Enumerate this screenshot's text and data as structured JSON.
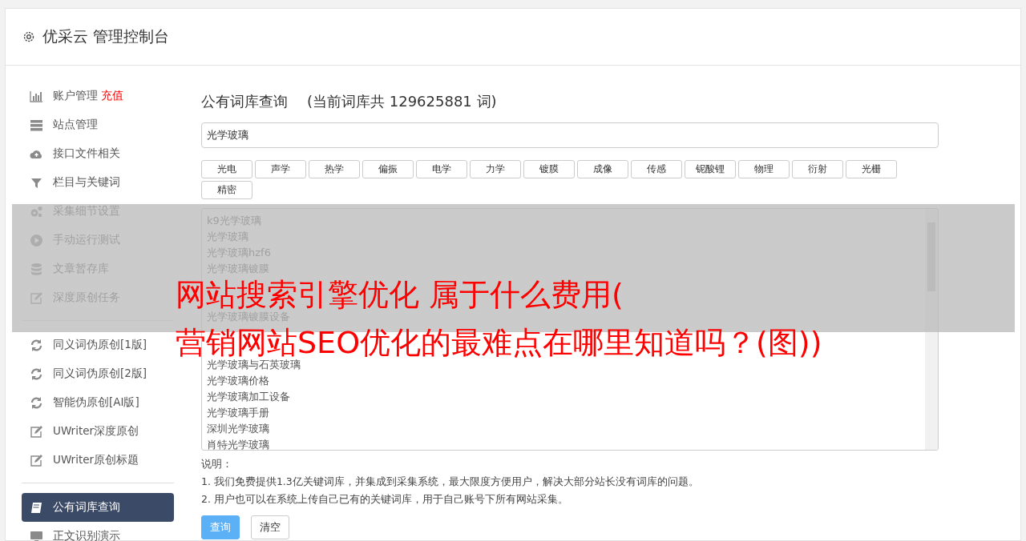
{
  "header": {
    "title": "优采云 管理控制台"
  },
  "sidebar": {
    "groups": [
      {
        "items": [
          {
            "kind": "chart",
            "label": "账户管理",
            "badge": "充值",
            "selected": false
          },
          {
            "kind": "server",
            "label": "站点管理",
            "selected": false
          },
          {
            "kind": "cloud",
            "label": "接口文件相关",
            "selected": false
          },
          {
            "kind": "filter",
            "label": "栏目与关键词",
            "selected": false
          },
          {
            "kind": "gears",
            "label": "采集细节设置",
            "selected": false
          },
          {
            "kind": "play",
            "label": "手动运行测试",
            "selected": false
          },
          {
            "kind": "database",
            "label": "文章暂存库",
            "selected": false
          },
          {
            "kind": "edit",
            "label": "深度原创任务",
            "selected": false
          }
        ]
      },
      {
        "items": [
          {
            "kind": "refresh",
            "label": "同义词伪原创[1版]",
            "selected": false
          },
          {
            "kind": "refresh",
            "label": "同义词伪原创[2版]",
            "selected": false
          },
          {
            "kind": "refresh",
            "label": "智能伪原创[AI版]",
            "selected": false
          },
          {
            "kind": "edit",
            "label": "UWriter深度原创",
            "selected": false
          },
          {
            "kind": "edit",
            "label": "UWriter原创标题",
            "selected": false
          }
        ]
      },
      {
        "items": [
          {
            "kind": "book",
            "label": "公有词库查询",
            "selected": true
          },
          {
            "kind": "monitor",
            "label": "正文识别演示",
            "selected": false
          }
        ]
      }
    ]
  },
  "main": {
    "title": "公有词库查询",
    "subtitle": "(当前词库共 129625881 词)",
    "search": {
      "value": "光学玻璃"
    },
    "tags": [
      "光电",
      "声学",
      "热学",
      "偏振",
      "电学",
      "力学",
      "镀膜",
      "成像",
      "传感",
      "铌酸锂",
      "物理",
      "衍射",
      "光栅",
      "精密"
    ],
    "results": [
      {
        "kind": "text",
        "text": "k9光学玻璃"
      },
      {
        "kind": "text",
        "text": "光学玻璃"
      },
      {
        "kind": "text",
        "text": "光学玻璃hzf6"
      },
      {
        "kind": "text",
        "text": "光学玻璃镀膜"
      },
      {
        "kind": "covered"
      },
      {
        "kind": "covered"
      },
      {
        "kind": "text",
        "text": "光学玻璃镀膜设备"
      },
      {
        "kind": "covered"
      },
      {
        "kind": "covered"
      },
      {
        "kind": "text",
        "text": "光学玻璃与石英玻璃"
      },
      {
        "kind": "text",
        "text": "光学玻璃价格"
      },
      {
        "kind": "text",
        "text": "光学玻璃加工设备"
      },
      {
        "kind": "text",
        "text": "光学玻璃手册"
      },
      {
        "kind": "text",
        "text": "深圳光学玻璃"
      },
      {
        "kind": "text",
        "text": "肖特光学玻璃"
      }
    ],
    "notes_title": "说明：",
    "notes": [
      "1. 我们免费提供1.3亿关键词库，并集成到采集系统，最大限度方便用户，解决大部分站长没有词库的问题。",
      "2. 用户也可以在系统上传自己已有的关键词库，用于自己账号下所有网站采集。"
    ],
    "buttons": [
      {
        "kind": "primary",
        "label": "查询"
      },
      {
        "kind": "default",
        "label": "清空"
      }
    ]
  },
  "overlay": {
    "lines": [
      "网站搜索引擎优化 属于什么费用(",
      "营销网站SEO优化的最难点在哪里知道吗？(图))"
    ]
  }
}
